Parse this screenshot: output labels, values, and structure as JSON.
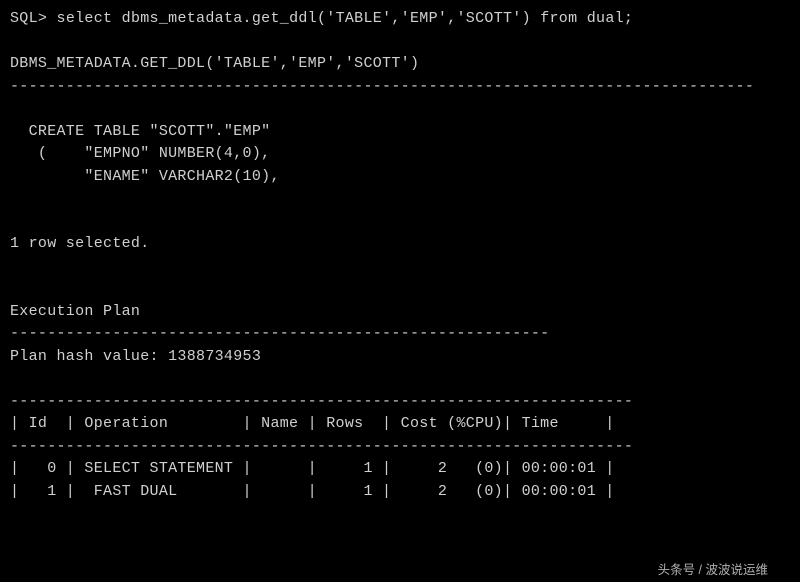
{
  "cmd": {
    "prompt": "SQL>",
    "statement": "select dbms_metadata.get_ddl('TABLE','EMP','SCOTT') from dual;"
  },
  "result_header": "DBMS_METADATA.GET_DDL('TABLE','EMP','SCOTT')",
  "hr": "--------------------------------------------------------------------------------",
  "ddl": {
    "l1": "  CREATE TABLE \"SCOTT\".\"EMP\"",
    "l2": "   (    \"EMPNO\" NUMBER(4,0),",
    "l3": "        \"ENAME\" VARCHAR2(10),"
  },
  "row_selected": "1 row selected.",
  "exec_plan_label": "Execution Plan",
  "exec_hr": "----------------------------------------------------------",
  "plan_hash": "Plan hash value: 1388734953",
  "plan_border": "-------------------------------------------------------------------",
  "plan_header": "| Id  | Operation        | Name | Rows  | Cost (%CPU)| Time     |",
  "plan_rows": {
    "r0": "|   0 | SELECT STATEMENT |      |     1 |     2   (0)| 00:00:01 |",
    "r1": "|   1 |  FAST DUAL       |      |     1 |     2   (0)| 00:00:01 |"
  },
  "watermark": "头条号 / 波波说运维"
}
